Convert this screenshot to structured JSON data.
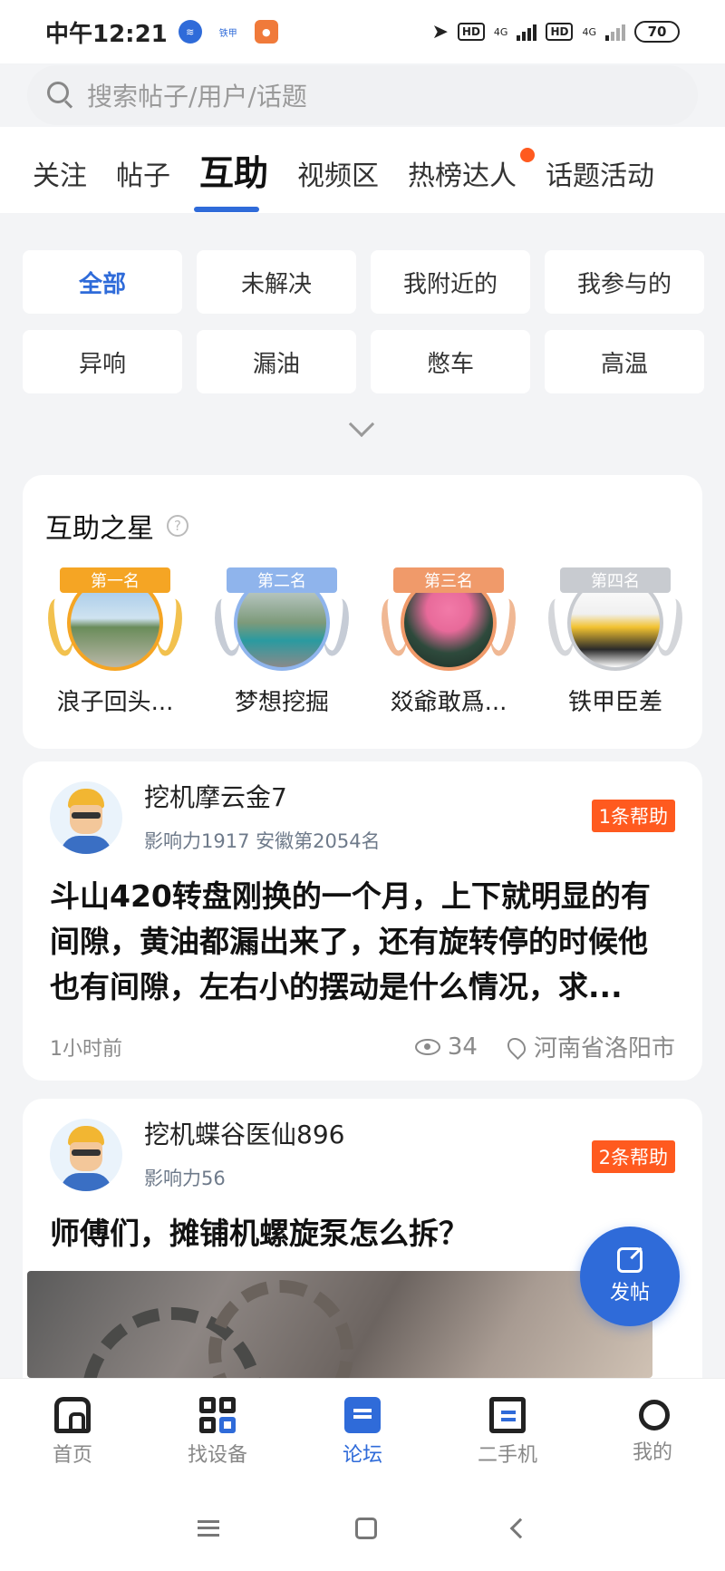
{
  "status_bar": {
    "time": "中午12:21",
    "app2_label": "铁甲",
    "network1": "HD",
    "net_type1": "4G",
    "network2": "HD",
    "net_type2": "4G",
    "battery": "70"
  },
  "search": {
    "placeholder": "搜索帖子/用户/话题"
  },
  "tabs": [
    {
      "label": "关注"
    },
    {
      "label": "帖子"
    },
    {
      "label": "互助",
      "active": true
    },
    {
      "label": "视频区"
    },
    {
      "label": "热榜达人",
      "has_dot": true
    },
    {
      "label": "话题活动"
    }
  ],
  "filters": [
    {
      "label": "全部",
      "active": true
    },
    {
      "label": "未解决"
    },
    {
      "label": "我附近的"
    },
    {
      "label": "我参与的"
    },
    {
      "label": "异响"
    },
    {
      "label": "漏油"
    },
    {
      "label": "憋车"
    },
    {
      "label": "高温"
    }
  ],
  "stars": {
    "title": "互助之星",
    "help_glyph": "?",
    "items": [
      {
        "rank": "第一名",
        "name": "浪子回头...",
        "color": "#f5a524"
      },
      {
        "rank": "第二名",
        "name": "梦想挖掘",
        "color": "#8fb4ec"
      },
      {
        "rank": "第三名",
        "name": "㸚爺敢爲...",
        "color": "#f09a6a"
      },
      {
        "rank": "第四名",
        "name": "铁甲臣差",
        "color": "#c8cbd0"
      }
    ]
  },
  "posts": [
    {
      "user": "挖机摩云金7",
      "meta": "影响力1917 安徽第2054名",
      "badge": "1条帮助",
      "title": "斗山420转盘刚换的一个月，上下就明显的有间隙，黄油都漏出来了，还有旋转停的时候他也有间隙，左右小的摆动是什么情况，求...",
      "time": "1小时前",
      "views": "34",
      "location": "河南省洛阳市"
    },
    {
      "user": "挖机蝶谷医仙896",
      "meta": "影响力56",
      "badge": "2条帮助",
      "title": "师傅们，摊铺机螺旋泵怎么拆？"
    }
  ],
  "fab": {
    "label": "发帖"
  },
  "bottom_nav": [
    {
      "label": "首页"
    },
    {
      "label": "找设备"
    },
    {
      "label": "论坛",
      "active": true
    },
    {
      "label": "二手机"
    },
    {
      "label": "我的"
    }
  ],
  "colors": {
    "accent": "#2f6bd9",
    "badge": "#ff5a1f"
  }
}
